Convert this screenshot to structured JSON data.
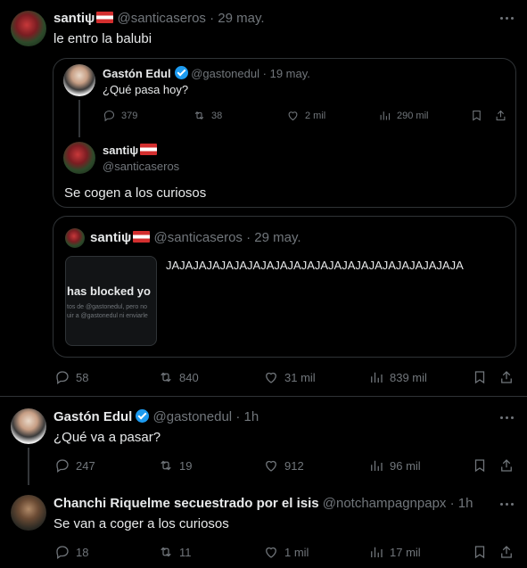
{
  "main_tweet": {
    "name": "santiψ",
    "handle": "@santicaseros",
    "time": "29 may.",
    "text": "le entro la balubi",
    "stats": {
      "replies": "58",
      "retweets": "840",
      "likes": "31 mil",
      "views": "839 mil"
    }
  },
  "quote_thread": {
    "parent": {
      "name": "Gastón Edul",
      "handle": "@gastonedul",
      "time": "19 may.",
      "text": "¿Qué pasa hoy?",
      "stats": {
        "replies": "379",
        "retweets": "38",
        "likes": "2 mil",
        "views": "290 mil"
      }
    },
    "reply": {
      "name": "santiψ",
      "handle": "@santicaseros",
      "text": "Se cogen a los curiosos"
    }
  },
  "quote_two": {
    "name": "santiψ",
    "handle": "@santicaseros",
    "time": "29 may.",
    "text": "JAJAJAJAJAJAJAJAJAJAJAJAJAJAJAJAJAJAJAJAJAJA",
    "thumb": {
      "big_text": "has blocked yo",
      "line1": "tos de @gastonedul, pero no",
      "line2": "uir a @gastonedul ni enviarle"
    }
  },
  "reply_one": {
    "name": "Gastón Edul",
    "handle": "@gastonedul",
    "time": "1h",
    "text": "¿Qué va a pasar?",
    "stats": {
      "replies": "247",
      "retweets": "19",
      "likes": "912",
      "views": "96 mil"
    }
  },
  "reply_two": {
    "name": "Chanchi Riquelme secuestrado por el isis",
    "handle": "@notchampagnpapx",
    "time": "1h",
    "text": "Se van a coger a los curiosos",
    "stats": {
      "replies": "18",
      "retweets": "11",
      "likes": "1 mil",
      "views": "17 mil"
    }
  },
  "separator": "·",
  "colors": {
    "background": "#000000",
    "text": "#e7e9ea",
    "muted": "#71767b",
    "border": "#2f3336",
    "verified": "#1d9bf0"
  },
  "icons": [
    "more-icon",
    "reply-icon",
    "retweet-icon",
    "like-icon",
    "views-icon",
    "bookmark-icon",
    "share-icon",
    "verified-badge-icon",
    "flag-icon"
  ]
}
